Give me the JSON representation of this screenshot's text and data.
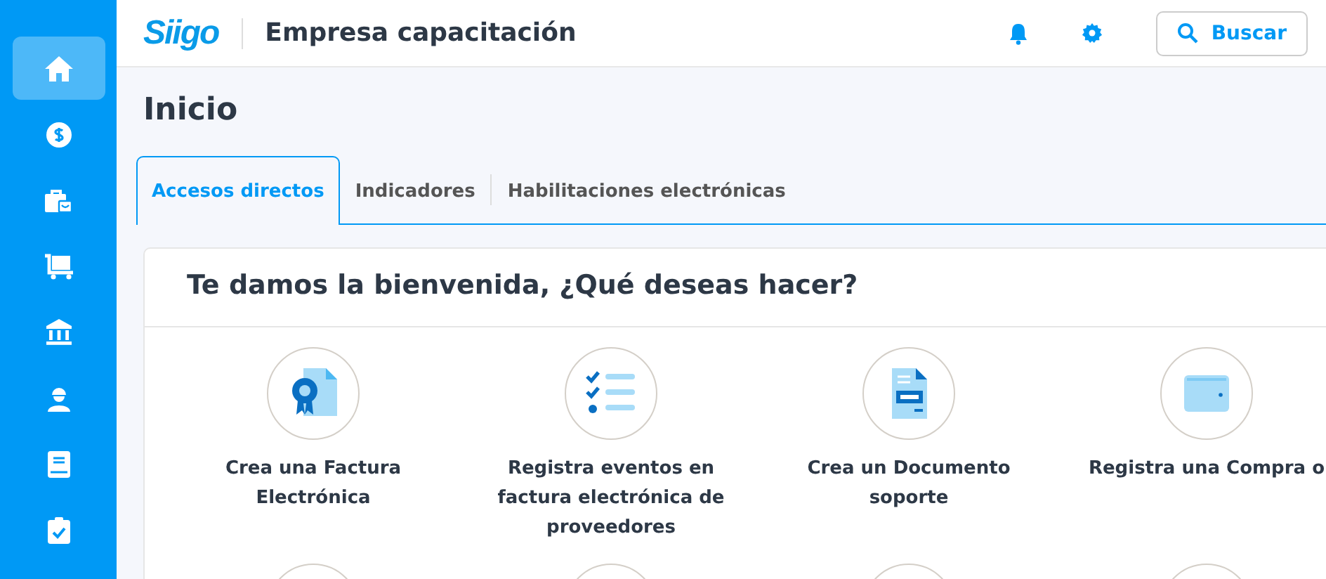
{
  "sidebar": {
    "items": [
      {
        "selected": true
      },
      {
        "selected": false
      },
      {
        "selected": false
      },
      {
        "selected": false
      },
      {
        "selected": false
      },
      {
        "selected": false
      },
      {
        "selected": false
      },
      {
        "selected": false
      }
    ]
  },
  "header": {
    "logo": "Siigo",
    "company": "Empresa capacitación",
    "search_button": "Buscar"
  },
  "page_title": "Inicio",
  "tabs": [
    {
      "label": "Accesos directos",
      "selected": true
    },
    {
      "label": "Indicadores",
      "selected": false
    },
    {
      "label": "Habilitaciones electrónicas",
      "selected": false
    }
  ],
  "welcome": {
    "title": "Te damos la bienvenida, ¿Qué deseas hacer?",
    "shortcuts": [
      {
        "label": "Crea una Factura Electrónica"
      },
      {
        "label": "Registra eventos en factura electrónica de proveedores"
      },
      {
        "label": "Crea un Documento soporte"
      },
      {
        "label": "Registra una Compra o"
      }
    ]
  }
}
